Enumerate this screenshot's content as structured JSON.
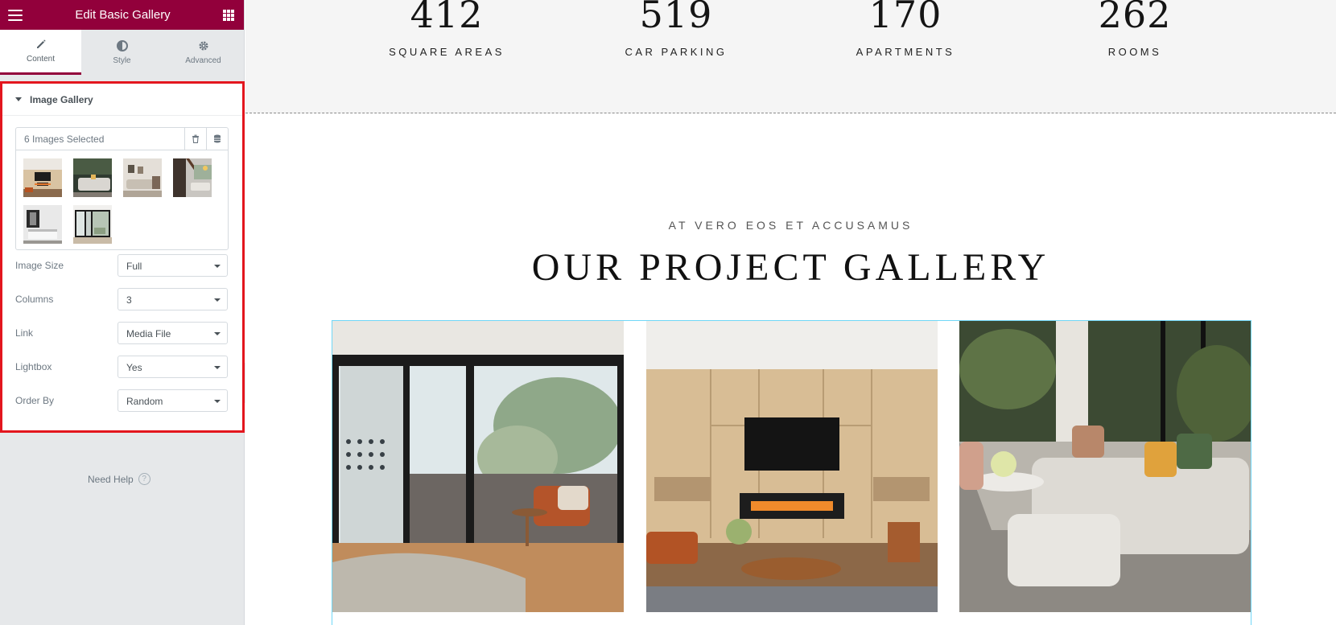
{
  "panel": {
    "title": "Edit Basic Gallery",
    "tabs": [
      {
        "label": "Content",
        "icon": "pencil-icon"
      },
      {
        "label": "Style",
        "icon": "half-circle-icon"
      },
      {
        "label": "Advanced",
        "icon": "gear-icon"
      }
    ],
    "section": {
      "title": "Image Gallery",
      "gallery": {
        "count_label": "6 Images Selected",
        "thumbnails": [
          "living-room-tv",
          "white-sofa-lounge",
          "beige-living-room",
          "stair-living-room",
          "bedroom-wardrobe",
          "window-view-room"
        ]
      },
      "fields": [
        {
          "label": "Image Size",
          "value": "Full"
        },
        {
          "label": "Columns",
          "value": "3"
        },
        {
          "label": "Link",
          "value": "Media File"
        },
        {
          "label": "Lightbox",
          "value": "Yes"
        },
        {
          "label": "Order By",
          "value": "Random"
        }
      ]
    },
    "help_label": "Need Help",
    "help_icon": "?"
  },
  "preview": {
    "stats": [
      {
        "number": "412",
        "label": "SQUARE AREAS"
      },
      {
        "number": "519",
        "label": "CAR PARKING"
      },
      {
        "number": "170",
        "label": "APARTMENTS"
      },
      {
        "number": "262",
        "label": "ROOMS"
      }
    ],
    "kicker": "AT VERO EOS ET ACCUSAMUS",
    "title": "OUR PROJECT GALLERY",
    "gallery_images": [
      "window-view-armchair",
      "fireplace-tv-wall",
      "sectional-sofa-room"
    ]
  },
  "colors": {
    "brand": "#92003b",
    "highlight_border": "#e3161e",
    "gallery_outline": "#71d7f7"
  }
}
